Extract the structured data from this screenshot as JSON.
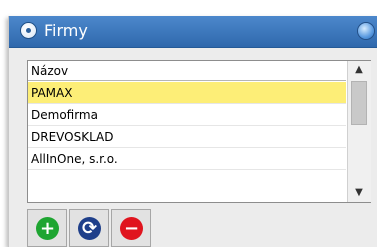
{
  "window": {
    "title": "Firmy"
  },
  "list": {
    "header": "Názov",
    "rows": [
      "PAMAX",
      "Demofirma",
      "DREVOSKLAD",
      "AllInOne, s.r.o."
    ],
    "selected_index": 0,
    "selected_color": "#fdee77"
  },
  "scrollbar": {
    "up_glyph": "▲",
    "down_glyph": "▼"
  },
  "toolbar": {
    "add_icon": "plus-icon",
    "add_glyph": "+",
    "add_color": "#1ea531",
    "refresh_icon": "refresh-icon",
    "refresh_glyph": "⟳",
    "refresh_color": "#1f3f8a",
    "remove_icon": "minus-icon",
    "remove_glyph": "−",
    "remove_color": "#e0141e"
  },
  "colors": {
    "titlebar": "#3a78c0",
    "background": "#ececec"
  }
}
